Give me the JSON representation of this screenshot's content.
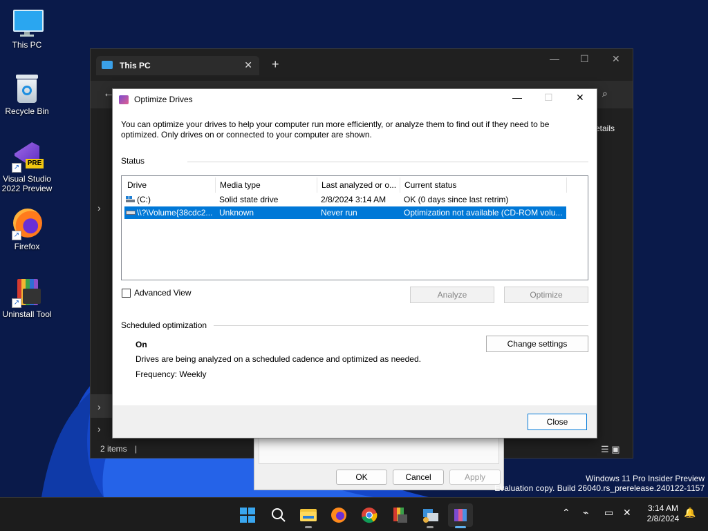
{
  "desktop": {
    "icons": [
      {
        "label": "This PC"
      },
      {
        "label": "Recycle Bin"
      },
      {
        "label": "Visual Studio 2022 Preview"
      },
      {
        "label": "Firefox"
      },
      {
        "label": "Uninstall Tool"
      }
    ],
    "vs_badge": "PRE"
  },
  "explorer": {
    "tab_title": "This PC",
    "details_label": "etails",
    "status_text": "2 items",
    "status_sep": "|"
  },
  "properties": {
    "ok_label": "OK",
    "cancel_label": "Cancel",
    "apply_label": "Apply"
  },
  "dialog": {
    "title": "Optimize Drives",
    "intro": "You can optimize your drives to help your computer run more efficiently, or analyze them to find out if they need to be optimized. Only drives on or connected to your computer are shown.",
    "status_label": "Status",
    "columns": [
      "Drive",
      "Media type",
      "Last analyzed or o...",
      "Current status"
    ],
    "drives": [
      {
        "drive": "(C:)",
        "media": "Solid state drive",
        "last": "2/8/2024 3:14 AM",
        "status": "OK (0 days since last retrim)",
        "selected": false
      },
      {
        "drive": "\\\\?\\Volume{38cdc2...",
        "media": "Unknown",
        "last": "Never run",
        "status": "Optimization not available (CD-ROM volu...",
        "selected": true
      }
    ],
    "advanced_view_label": "Advanced View",
    "analyze_label": "Analyze",
    "optimize_label": "Optimize",
    "scheduled_label": "Scheduled optimization",
    "schedule_state": "On",
    "schedule_desc": "Drives are being analyzed on a scheduled cadence and optimized as needed.",
    "frequency": "Frequency: Weekly",
    "change_settings_label": "Change settings",
    "close_label": "Close",
    "accent_color": "#0078d7"
  },
  "watermark": {
    "line1": "Windows 11 Pro Insider Preview",
    "line2": "Evaluation copy. Build 26040.rs_prerelease.240122-1157"
  },
  "taskbar": {
    "apps": [
      "start-icon",
      "search-icon",
      "file-explorer-icon",
      "firefox-icon",
      "chrome-icon",
      "uninstall-tool-icon",
      "app-icon",
      "optimize-drives-icon"
    ],
    "time": "3:14 AM",
    "date": "2/8/2024"
  }
}
